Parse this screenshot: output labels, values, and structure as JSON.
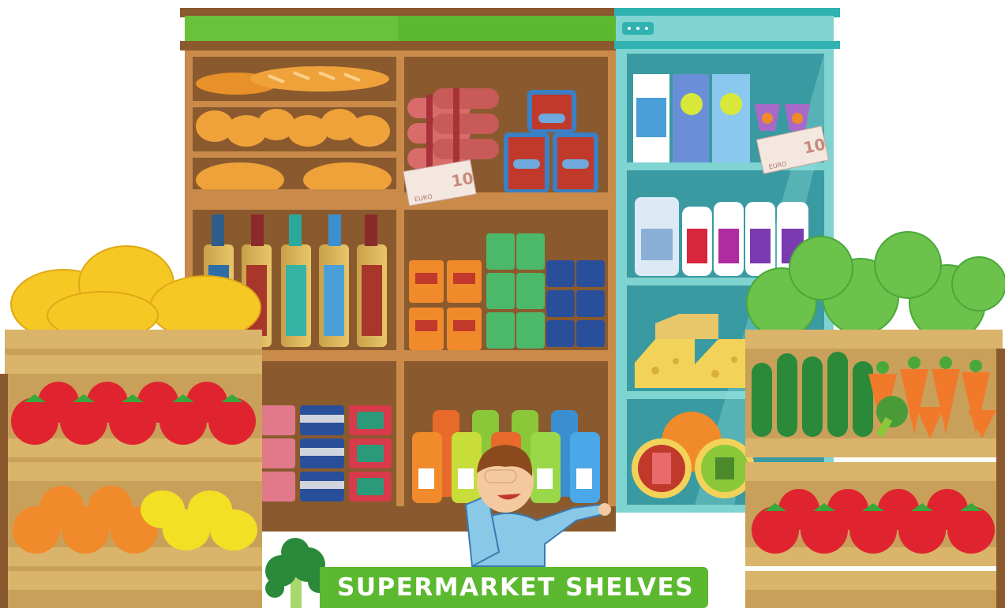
{
  "title": "SUPERMARKET SHELVES",
  "banknotes": [
    {
      "value": "10",
      "currency": "EURO"
    },
    {
      "value": "10",
      "currency": "EURO"
    }
  ],
  "colors": {
    "shelf_wood": "#c98a4a",
    "shelf_back": "#8a5a2e",
    "fridge": "#7fd3d0",
    "fridge_top": "#2fb2b0",
    "banner_green": "#5cb82e",
    "crate": "#d9b46a"
  },
  "icons": [
    "broccoli-icon",
    "boy-character",
    "banknote-icon"
  ]
}
